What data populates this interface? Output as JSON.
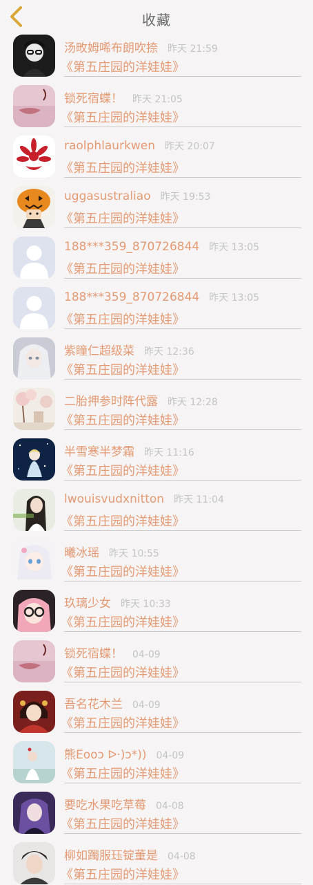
{
  "header": {
    "title": "收藏",
    "back_icon": "chevron-left-icon",
    "accent_color": "#d9a638"
  },
  "colors": {
    "name": "#e49a73",
    "time": "#c4c4c4",
    "background": "#f6f4f5"
  },
  "items": [
    {
      "name": "汤畋姆唏布朗吹捺",
      "time": "昨天 21:59",
      "game": "《第五庄园的洋娃娃》",
      "avatar": "dark-portrait-avatar"
    },
    {
      "name": "锁死宿蝶！",
      "time": "昨天 21:05",
      "game": "《第五庄园的洋娃娃》",
      "avatar": "pink-lips-avatar"
    },
    {
      "name": "raolphlaurkwen",
      "time": "昨天 20:07",
      "game": "《第五庄园的洋娃娃》",
      "avatar": "red-flower-avatar"
    },
    {
      "name": "uggasustraliao",
      "time": "昨天 19:53",
      "game": "《第五庄园的洋娃娃》",
      "avatar": "pumpkin-character-avatar"
    },
    {
      "name": "188***359_870726844",
      "time": "昨天 13:05",
      "game": "《第五庄园的洋娃娃》",
      "avatar": "default-person-avatar"
    },
    {
      "name": "188***359_870726844",
      "time": "昨天 13:05",
      "game": "《第五庄园的洋娃娃》",
      "avatar": "default-person-avatar"
    },
    {
      "name": "紫瞳仁超级菜",
      "time": "昨天 12:36",
      "game": "《第五庄园的洋娃娃》",
      "avatar": "white-hair-anime-avatar"
    },
    {
      "name": "二胎押参时阵代露",
      "time": "昨天 12:28",
      "game": "《第五庄园的洋娃娃》",
      "avatar": "blossom-scene-avatar"
    },
    {
      "name": "半雪寒半梦霜",
      "time": "昨天 11:16",
      "game": "《第五庄园的洋娃娃》",
      "avatar": "night-sky-anime-avatar"
    },
    {
      "name": "lwouisvudxnitton",
      "time": "昨天 11:04",
      "game": "《第五庄园的洋娃娃》",
      "avatar": "girl-photo-avatar"
    },
    {
      "name": "曦冰瑶",
      "time": "昨天 10:55",
      "game": "《第五庄园的洋娃娃》",
      "avatar": "white-hair-girl-avatar"
    },
    {
      "name": "玖璃少女",
      "time": "昨天 10:33",
      "game": "《第五庄园的洋娃娃》",
      "avatar": "pink-hair-glasses-avatar"
    },
    {
      "name": "锁死宿蝶！",
      "time": "04-09",
      "game": "《第五庄园的洋娃娃》",
      "avatar": "pink-lips-avatar"
    },
    {
      "name": "吾名花木兰",
      "time": "04-09",
      "game": "《第五庄园的洋娃娃》",
      "avatar": "red-costume-avatar"
    },
    {
      "name": "熊Eooↄ ᐅ·)ↄ*))",
      "time": "04-09",
      "game": "《第五庄园的洋娃娃》",
      "avatar": "girl-landscape-avatar"
    },
    {
      "name": "要吃水果吃草莓",
      "time": "04-08",
      "game": "《第五庄园的洋娃娃》",
      "avatar": "purple-hair-avatar"
    },
    {
      "name": "柳如躅服珏锭董是",
      "time": "04-08",
      "game": "《第五庄园的洋娃娃》",
      "avatar": "boy-photo-avatar"
    }
  ]
}
